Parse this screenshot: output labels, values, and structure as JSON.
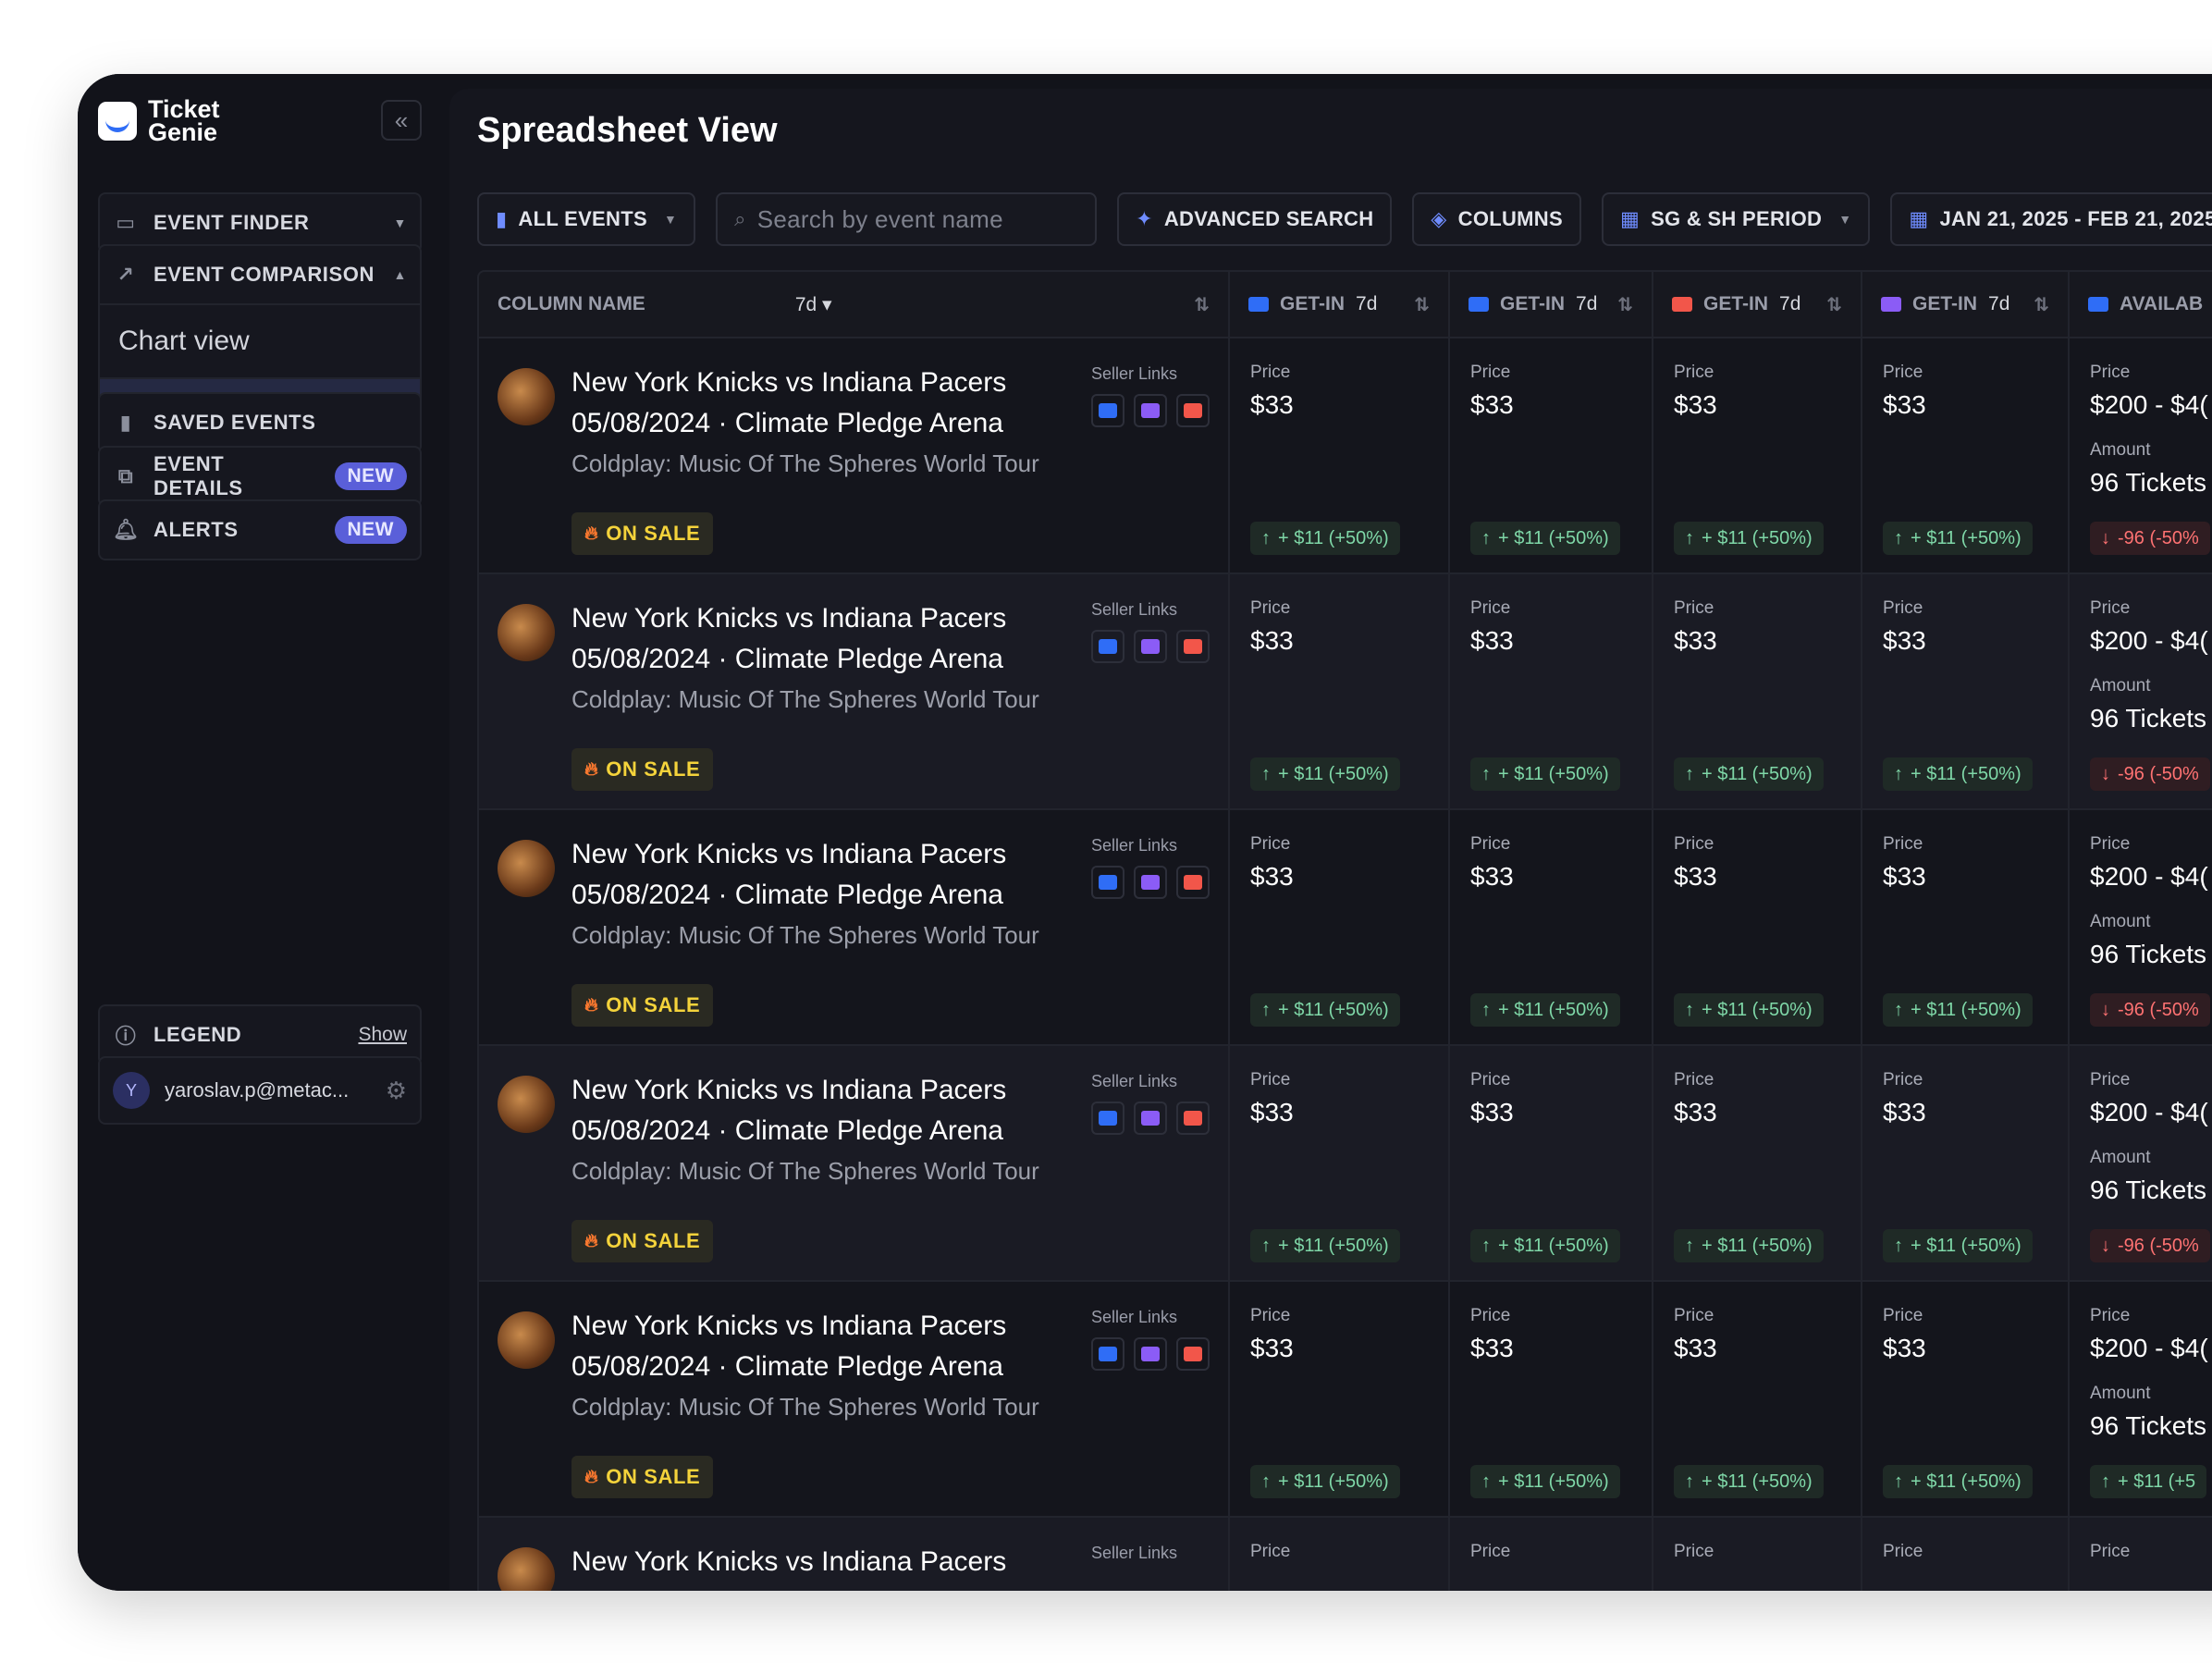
{
  "app": {
    "logo_line1": "Ticket",
    "logo_line2": "Genie"
  },
  "sidebar": {
    "collapse_icon": "double-chevron-left-icon",
    "event_finder": "EVENT FINDER",
    "event_comparison": "EVENT COMPARISON",
    "chart_view": "Chart view",
    "spreadsheet_view": "Spreadsheet View",
    "saved_events": "SAVED EVENTS",
    "event_details": "EVENT DETAILS",
    "event_details_badge": "NEW",
    "alerts": "ALERTS",
    "alerts_badge": "NEW",
    "legend": "LEGEND",
    "legend_show": "Show",
    "user_initial": "Y",
    "user_email": "yaroslav.p@metac..."
  },
  "main": {
    "title": "Spreadsheet View",
    "toolbar": {
      "all_events": "ALL EVENTS",
      "search_placeholder": "Search by event name",
      "advanced_search": "ADVANCED SEARCH",
      "columns": "COLUMNS",
      "period": "SG & SH PERIOD",
      "date_range": "JAN 21, 2025 - FEB 21, 2025"
    },
    "table": {
      "col_name": "COLUMN NAME",
      "col_days": "7d",
      "columns": [
        {
          "label": "GET-IN",
          "days": "7d",
          "color": "#2f6df6"
        },
        {
          "label": "GET-IN",
          "days": "7d",
          "color": "#2f6df6"
        },
        {
          "label": "GET-IN",
          "days": "7d",
          "color": "#f2564a"
        },
        {
          "label": "GET-IN",
          "days": "7d",
          "color": "#8b5cf6"
        },
        {
          "label": "AVAILAB",
          "days": "",
          "color": "#2f6df6"
        }
      ],
      "labels": {
        "seller_links": "Seller Links",
        "price": "Price",
        "amount": "Amount"
      },
      "rows": [
        {
          "title1": "New York Knicks vs Indiana Pacers",
          "title2": "05/08/2024 · Climate Pledge Arena",
          "subtitle": "Coldplay: Music Of The Spheres World Tour",
          "status": "ON SALE",
          "prices": [
            "$33",
            "$33",
            "$33",
            "$33"
          ],
          "deltas": [
            "+ $11 (+50%)",
            "+ $11 (+50%)",
            "+ $11 (+50%)",
            "+ $11 (+50%)"
          ],
          "avail_price": "$200 - $4(",
          "avail_amount": "96 Tickets",
          "avail_delta": "-96 (-50%",
          "avail_dir": "down"
        },
        {
          "title1": "New York Knicks vs Indiana Pacers",
          "title2": "05/08/2024 · Climate Pledge Arena",
          "subtitle": "Coldplay: Music Of The Spheres World Tour",
          "status": "ON SALE",
          "prices": [
            "$33",
            "$33",
            "$33",
            "$33"
          ],
          "deltas": [
            "+ $11 (+50%)",
            "+ $11 (+50%)",
            "+ $11 (+50%)",
            "+ $11 (+50%)"
          ],
          "avail_price": "$200 - $4(",
          "avail_amount": "96 Tickets",
          "avail_delta": "-96 (-50%",
          "avail_dir": "down"
        },
        {
          "title1": "New York Knicks vs Indiana Pacers",
          "title2": "05/08/2024 · Climate Pledge Arena",
          "subtitle": "Coldplay: Music Of The Spheres World Tour",
          "status": "ON SALE",
          "prices": [
            "$33",
            "$33",
            "$33",
            "$33"
          ],
          "deltas": [
            "+ $11 (+50%)",
            "+ $11 (+50%)",
            "+ $11 (+50%)",
            "+ $11 (+50%)"
          ],
          "avail_price": "$200 - $4(",
          "avail_amount": "96 Tickets",
          "avail_delta": "-96 (-50%",
          "avail_dir": "down"
        },
        {
          "title1": "New York Knicks vs Indiana Pacers",
          "title2": "05/08/2024 · Climate Pledge Arena",
          "subtitle": "Coldplay: Music Of The Spheres World Tour",
          "status": "ON SALE",
          "prices": [
            "$33",
            "$33",
            "$33",
            "$33"
          ],
          "deltas": [
            "+ $11 (+50%)",
            "+ $11 (+50%)",
            "+ $11 (+50%)",
            "+ $11 (+50%)"
          ],
          "avail_price": "$200 - $4(",
          "avail_amount": "96 Tickets",
          "avail_delta": "-96 (-50%",
          "avail_dir": "down"
        },
        {
          "title1": "New York Knicks vs Indiana Pacers",
          "title2": "05/08/2024 · Climate Pledge Arena",
          "subtitle": "Coldplay: Music Of The Spheres World Tour",
          "status": "ON SALE",
          "prices": [
            "$33",
            "$33",
            "$33",
            "$33"
          ],
          "deltas": [
            "+ $11 (+50%)",
            "+ $11 (+50%)",
            "+ $11 (+50%)",
            "+ $11 (+50%)"
          ],
          "avail_price": "$200 - $4(",
          "avail_amount": "96 Tickets",
          "avail_delta": "+ $11 (+5",
          "avail_dir": "up"
        },
        {
          "title1": "New York Knicks vs Indiana Pacers",
          "title2": "",
          "subtitle": "",
          "status": "",
          "prices": [
            "",
            "",
            "",
            ""
          ],
          "deltas": [
            "",
            "",
            "",
            ""
          ],
          "avail_price": "",
          "avail_amount": "",
          "avail_delta": "",
          "avail_dir": ""
        }
      ]
    }
  },
  "colors": {
    "blue": "#2f6df6",
    "purple": "#8b5cf6",
    "red": "#f2564a",
    "accent": "#5a5fd9"
  }
}
